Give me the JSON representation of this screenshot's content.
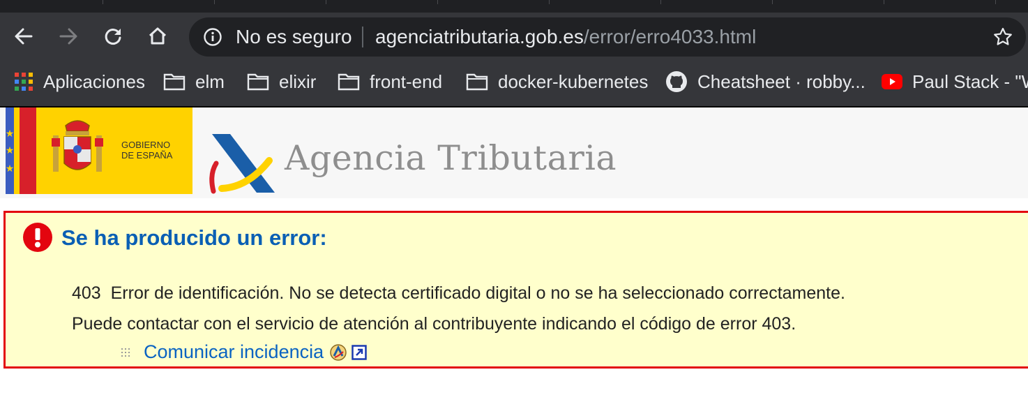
{
  "browser": {
    "security_label": "No es seguro",
    "url_host": "agenciatributaria.gob.es",
    "url_path": "/error/erro4033.html",
    "icons": {
      "back": "back-arrow-icon",
      "forward": "forward-arrow-icon",
      "reload": "reload-icon",
      "home": "home-icon",
      "info": "info-icon",
      "star": "star-icon"
    },
    "colors": {
      "toolbar": "#35363a",
      "omnibox": "#202124",
      "text": "#e8eaed",
      "path": "#9aa0a6"
    }
  },
  "bookmarks": [
    {
      "label": "Aplicaciones",
      "icon": "apps-grid-icon"
    },
    {
      "label": "elm",
      "icon": "folder-icon"
    },
    {
      "label": "elixir",
      "icon": "folder-icon"
    },
    {
      "label": "front-end",
      "icon": "folder-icon"
    },
    {
      "label": "docker-kubernetes",
      "icon": "folder-icon"
    },
    {
      "label": "Cheatsheet · robby...",
      "icon": "github-icon"
    },
    {
      "label": "Paul Stack - \"W",
      "icon": "youtube-icon"
    }
  ],
  "header": {
    "gov_line1": "GOBIERNO",
    "gov_line2": "DE ESPAÑA",
    "agency_name": "Agencia Tributaria"
  },
  "error": {
    "title": "Se ha producido un error:",
    "code": "403",
    "message": "Error de identificación. No se detecta certificado digital o no se ha seleccionado correctamente.",
    "contact": "Puede contactar con el servicio de atención al contribuyente indicando el código de error 403.",
    "link_label": "Comunicar incidencia",
    "colors": {
      "border": "#e3050f",
      "background": "#ffffcc",
      "title": "#0a5fb4",
      "link": "#0a63c2"
    }
  }
}
